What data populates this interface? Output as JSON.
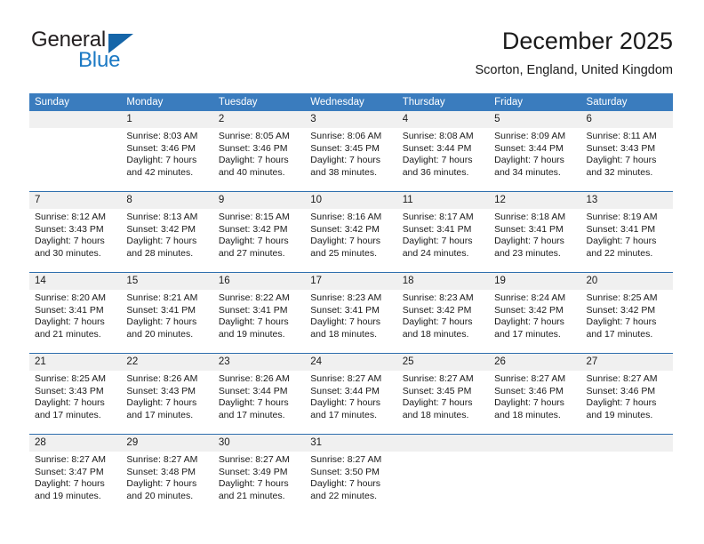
{
  "brand": {
    "name_top": "General",
    "name_bottom": "Blue",
    "accent_color": "#1b79c4"
  },
  "header": {
    "title": "December 2025",
    "subtitle": "Scorton, England, United Kingdom"
  },
  "calendar": {
    "header_color": "#3a7cbe",
    "weekday_headers": [
      "Sunday",
      "Monday",
      "Tuesday",
      "Wednesday",
      "Thursday",
      "Friday",
      "Saturday"
    ],
    "weeks": [
      {
        "days": [
          {
            "num": "",
            "sunrise": "",
            "sunset": "",
            "daylight1": "",
            "daylight2": ""
          },
          {
            "num": "1",
            "sunrise": "Sunrise: 8:03 AM",
            "sunset": "Sunset: 3:46 PM",
            "daylight1": "Daylight: 7 hours",
            "daylight2": "and 42 minutes."
          },
          {
            "num": "2",
            "sunrise": "Sunrise: 8:05 AM",
            "sunset": "Sunset: 3:46 PM",
            "daylight1": "Daylight: 7 hours",
            "daylight2": "and 40 minutes."
          },
          {
            "num": "3",
            "sunrise": "Sunrise: 8:06 AM",
            "sunset": "Sunset: 3:45 PM",
            "daylight1": "Daylight: 7 hours",
            "daylight2": "and 38 minutes."
          },
          {
            "num": "4",
            "sunrise": "Sunrise: 8:08 AM",
            "sunset": "Sunset: 3:44 PM",
            "daylight1": "Daylight: 7 hours",
            "daylight2": "and 36 minutes."
          },
          {
            "num": "5",
            "sunrise": "Sunrise: 8:09 AM",
            "sunset": "Sunset: 3:44 PM",
            "daylight1": "Daylight: 7 hours",
            "daylight2": "and 34 minutes."
          },
          {
            "num": "6",
            "sunrise": "Sunrise: 8:11 AM",
            "sunset": "Sunset: 3:43 PM",
            "daylight1": "Daylight: 7 hours",
            "daylight2": "and 32 minutes."
          }
        ]
      },
      {
        "days": [
          {
            "num": "7",
            "sunrise": "Sunrise: 8:12 AM",
            "sunset": "Sunset: 3:43 PM",
            "daylight1": "Daylight: 7 hours",
            "daylight2": "and 30 minutes."
          },
          {
            "num": "8",
            "sunrise": "Sunrise: 8:13 AM",
            "sunset": "Sunset: 3:42 PM",
            "daylight1": "Daylight: 7 hours",
            "daylight2": "and 28 minutes."
          },
          {
            "num": "9",
            "sunrise": "Sunrise: 8:15 AM",
            "sunset": "Sunset: 3:42 PM",
            "daylight1": "Daylight: 7 hours",
            "daylight2": "and 27 minutes."
          },
          {
            "num": "10",
            "sunrise": "Sunrise: 8:16 AM",
            "sunset": "Sunset: 3:42 PM",
            "daylight1": "Daylight: 7 hours",
            "daylight2": "and 25 minutes."
          },
          {
            "num": "11",
            "sunrise": "Sunrise: 8:17 AM",
            "sunset": "Sunset: 3:41 PM",
            "daylight1": "Daylight: 7 hours",
            "daylight2": "and 24 minutes."
          },
          {
            "num": "12",
            "sunrise": "Sunrise: 8:18 AM",
            "sunset": "Sunset: 3:41 PM",
            "daylight1": "Daylight: 7 hours",
            "daylight2": "and 23 minutes."
          },
          {
            "num": "13",
            "sunrise": "Sunrise: 8:19 AM",
            "sunset": "Sunset: 3:41 PM",
            "daylight1": "Daylight: 7 hours",
            "daylight2": "and 22 minutes."
          }
        ]
      },
      {
        "days": [
          {
            "num": "14",
            "sunrise": "Sunrise: 8:20 AM",
            "sunset": "Sunset: 3:41 PM",
            "daylight1": "Daylight: 7 hours",
            "daylight2": "and 21 minutes."
          },
          {
            "num": "15",
            "sunrise": "Sunrise: 8:21 AM",
            "sunset": "Sunset: 3:41 PM",
            "daylight1": "Daylight: 7 hours",
            "daylight2": "and 20 minutes."
          },
          {
            "num": "16",
            "sunrise": "Sunrise: 8:22 AM",
            "sunset": "Sunset: 3:41 PM",
            "daylight1": "Daylight: 7 hours",
            "daylight2": "and 19 minutes."
          },
          {
            "num": "17",
            "sunrise": "Sunrise: 8:23 AM",
            "sunset": "Sunset: 3:41 PM",
            "daylight1": "Daylight: 7 hours",
            "daylight2": "and 18 minutes."
          },
          {
            "num": "18",
            "sunrise": "Sunrise: 8:23 AM",
            "sunset": "Sunset: 3:42 PM",
            "daylight1": "Daylight: 7 hours",
            "daylight2": "and 18 minutes."
          },
          {
            "num": "19",
            "sunrise": "Sunrise: 8:24 AM",
            "sunset": "Sunset: 3:42 PM",
            "daylight1": "Daylight: 7 hours",
            "daylight2": "and 17 minutes."
          },
          {
            "num": "20",
            "sunrise": "Sunrise: 8:25 AM",
            "sunset": "Sunset: 3:42 PM",
            "daylight1": "Daylight: 7 hours",
            "daylight2": "and 17 minutes."
          }
        ]
      },
      {
        "days": [
          {
            "num": "21",
            "sunrise": "Sunrise: 8:25 AM",
            "sunset": "Sunset: 3:43 PM",
            "daylight1": "Daylight: 7 hours",
            "daylight2": "and 17 minutes."
          },
          {
            "num": "22",
            "sunrise": "Sunrise: 8:26 AM",
            "sunset": "Sunset: 3:43 PM",
            "daylight1": "Daylight: 7 hours",
            "daylight2": "and 17 minutes."
          },
          {
            "num": "23",
            "sunrise": "Sunrise: 8:26 AM",
            "sunset": "Sunset: 3:44 PM",
            "daylight1": "Daylight: 7 hours",
            "daylight2": "and 17 minutes."
          },
          {
            "num": "24",
            "sunrise": "Sunrise: 8:27 AM",
            "sunset": "Sunset: 3:44 PM",
            "daylight1": "Daylight: 7 hours",
            "daylight2": "and 17 minutes."
          },
          {
            "num": "25",
            "sunrise": "Sunrise: 8:27 AM",
            "sunset": "Sunset: 3:45 PM",
            "daylight1": "Daylight: 7 hours",
            "daylight2": "and 18 minutes."
          },
          {
            "num": "26",
            "sunrise": "Sunrise: 8:27 AM",
            "sunset": "Sunset: 3:46 PM",
            "daylight1": "Daylight: 7 hours",
            "daylight2": "and 18 minutes."
          },
          {
            "num": "27",
            "sunrise": "Sunrise: 8:27 AM",
            "sunset": "Sunset: 3:46 PM",
            "daylight1": "Daylight: 7 hours",
            "daylight2": "and 19 minutes."
          }
        ]
      },
      {
        "days": [
          {
            "num": "28",
            "sunrise": "Sunrise: 8:27 AM",
            "sunset": "Sunset: 3:47 PM",
            "daylight1": "Daylight: 7 hours",
            "daylight2": "and 19 minutes."
          },
          {
            "num": "29",
            "sunrise": "Sunrise: 8:27 AM",
            "sunset": "Sunset: 3:48 PM",
            "daylight1": "Daylight: 7 hours",
            "daylight2": "and 20 minutes."
          },
          {
            "num": "30",
            "sunrise": "Sunrise: 8:27 AM",
            "sunset": "Sunset: 3:49 PM",
            "daylight1": "Daylight: 7 hours",
            "daylight2": "and 21 minutes."
          },
          {
            "num": "31",
            "sunrise": "Sunrise: 8:27 AM",
            "sunset": "Sunset: 3:50 PM",
            "daylight1": "Daylight: 7 hours",
            "daylight2": "and 22 minutes."
          },
          {
            "num": "",
            "sunrise": "",
            "sunset": "",
            "daylight1": "",
            "daylight2": ""
          },
          {
            "num": "",
            "sunrise": "",
            "sunset": "",
            "daylight1": "",
            "daylight2": ""
          },
          {
            "num": "",
            "sunrise": "",
            "sunset": "",
            "daylight1": "",
            "daylight2": ""
          }
        ]
      }
    ]
  }
}
